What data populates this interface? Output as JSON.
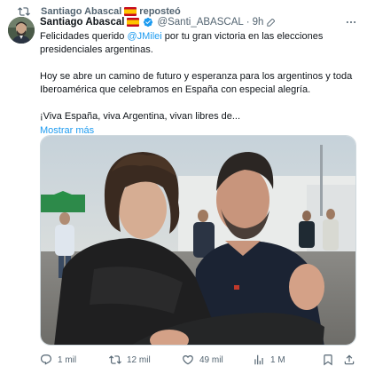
{
  "repost": {
    "user": "Santiago Abascal",
    "label": "reposteó"
  },
  "tweet": {
    "display_name": "Santiago Abascal",
    "handle": "@Santi_ABASCAL",
    "separator": "·",
    "time": "9h",
    "text": {
      "line1_before": "Felicidades querido ",
      "mention": "@JMilei",
      "line1_after": " por tu gran victoria en las elecciones presidenciales argentinas.",
      "paragraph2": "Hoy se abre un camino de futuro y esperanza para los argentinos y toda Iberoamérica que celebramos en España con especial alegría.",
      "paragraph3": "¡Viva España, viva Argentina, vivan libres de..."
    },
    "show_more": "Mostrar más"
  },
  "actions": {
    "replies": "1 mil",
    "reposts": "12 mil",
    "likes": "49 mil",
    "views": "1 M"
  },
  "colors": {
    "accent": "#1d9bf0",
    "muted": "#536471",
    "spain_red": "#c60b1e",
    "spain_yellow": "#ffc400"
  },
  "icons": [
    "repost-icon",
    "spain-flag-icon",
    "verified-badge-icon",
    "edit-icon",
    "more-icon",
    "reply-icon",
    "like-icon",
    "views-icon",
    "bookmark-icon",
    "share-icon"
  ]
}
